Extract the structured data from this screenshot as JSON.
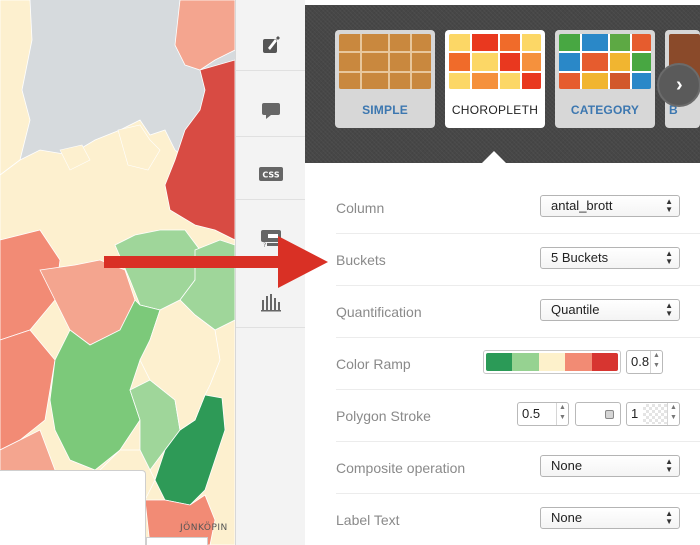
{
  "map": {
    "place_label": "JÖNKÖPIN",
    "colors": {
      "water": "#d6dadd",
      "land_neutral": "#fdf0cf",
      "red_dark": "#d84b43",
      "salmon": "#f28b75",
      "salmon_light": "#f4a58f",
      "green_light": "#9fd69a",
      "green_mid": "#7cc97a",
      "green_dark": "#2e9a57"
    }
  },
  "toolbar": {
    "items": [
      {
        "name": "wizard-brush-icon",
        "active": true
      },
      {
        "name": "infowindow-speech-icon",
        "active": false
      },
      {
        "name": "css-icon",
        "active": false
      },
      {
        "name": "legend-icon",
        "active": false
      },
      {
        "name": "histogram-icon",
        "active": false
      }
    ]
  },
  "wizard": {
    "types": [
      {
        "label": "SIMPLE",
        "selected": false
      },
      {
        "label": "CHOROPLETH",
        "selected": true
      },
      {
        "label": "CATEGORY",
        "selected": false
      },
      {
        "label": "B",
        "selected": false
      }
    ],
    "next_icon": "›"
  },
  "form": {
    "column": {
      "label": "Column",
      "value": "antal_brott"
    },
    "buckets": {
      "label": "Buckets",
      "value": "5 Buckets"
    },
    "quantification": {
      "label": "Quantification",
      "value": "Quantile"
    },
    "color_ramp": {
      "label": "Color Ramp",
      "colors": [
        "#2b9a57",
        "#96d291",
        "#fdf1cb",
        "#f28b74",
        "#d73530"
      ],
      "opacity": "0.8"
    },
    "polygon_stroke": {
      "label": "Polygon Stroke",
      "width": "0.5",
      "opacity": "1"
    },
    "composite": {
      "label": "Composite operation",
      "value": "None"
    },
    "label_text": {
      "label": "Label Text",
      "value": "None"
    }
  },
  "annotation": {
    "arrow_color": "#d93025"
  }
}
